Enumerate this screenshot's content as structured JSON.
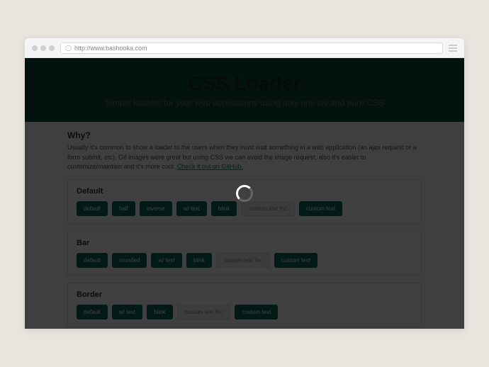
{
  "browser": {
    "url": "http://www.bashooka.com"
  },
  "hero": {
    "title": "CSS Loader",
    "subtitle": "Simple loaders for your web applications using only one div and pure CSS"
  },
  "why": {
    "heading": "Why?",
    "text": "Usually it's common to show a loader to the users when they must wait something in a web application (an ajax request or a form submit, etc). Gif images were great but using CSS we can avoid the image request, also it's easier to customize/maintain and it's more cool.",
    "link_text": "Check it out on GitHub."
  },
  "sections": [
    {
      "title": "Default",
      "buttons": [
        {
          "label": "default",
          "type": "primary"
        },
        {
          "label": "half",
          "type": "primary"
        },
        {
          "label": "inverse",
          "type": "primary"
        },
        {
          "label": "w/ text",
          "type": "primary"
        },
        {
          "label": "blink",
          "type": "primary"
        },
        {
          "label": "custom text fnc",
          "type": "secondary"
        },
        {
          "label": "custom text",
          "type": "primary"
        }
      ]
    },
    {
      "title": "Bar",
      "buttons": [
        {
          "label": "default",
          "type": "primary"
        },
        {
          "label": "rounded",
          "type": "primary"
        },
        {
          "label": "w/ text",
          "type": "primary"
        },
        {
          "label": "blink",
          "type": "primary"
        },
        {
          "label": "custom text fnc",
          "type": "secondary"
        },
        {
          "label": "custom text",
          "type": "primary"
        }
      ]
    },
    {
      "title": "Border",
      "buttons": [
        {
          "label": "default",
          "type": "primary"
        },
        {
          "label": "w/ text",
          "type": "primary"
        },
        {
          "label": "blink",
          "type": "primary"
        },
        {
          "label": "custom text fnc",
          "type": "secondary"
        },
        {
          "label": "custom text",
          "type": "primary"
        }
      ]
    }
  ]
}
